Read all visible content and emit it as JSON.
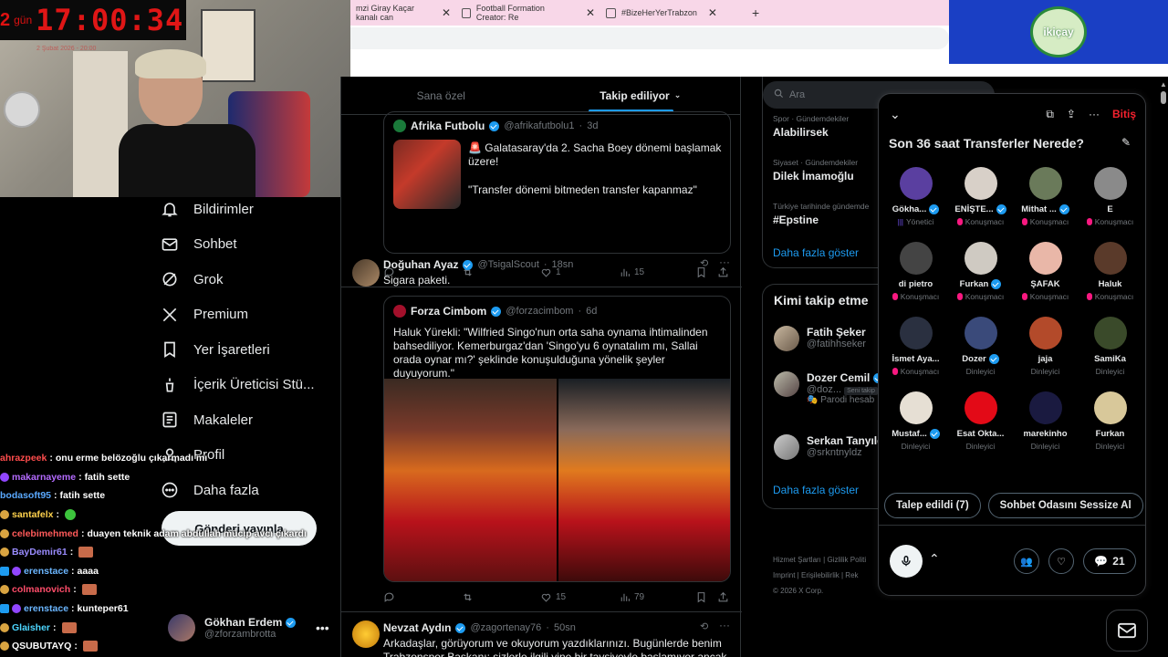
{
  "browser": {
    "tabs": [
      {
        "title": "mzi Giray Kaçar kanalı can"
      },
      {
        "title": "Football Formation Creator: Re"
      },
      {
        "title": "#BizeHerYerTrabzon"
      }
    ],
    "sponsor": "ikiçay"
  },
  "stream": {
    "days": "2",
    "days_label": "gün",
    "timer": "17:00:34",
    "timer_sub": "2 Şubat 2026 - 20:00"
  },
  "nav": {
    "items": [
      {
        "label": "Bildirimler",
        "icon": "bell-icon"
      },
      {
        "label": "Sohbet",
        "icon": "mail-icon"
      },
      {
        "label": "Grok",
        "icon": "grok-icon"
      },
      {
        "label": "Premium",
        "icon": "x-icon"
      },
      {
        "label": "Yer İşaretleri",
        "icon": "bookmark-icon"
      },
      {
        "label": "İçerik Üreticisi Stü...",
        "icon": "creator-icon"
      },
      {
        "label": "Makaleler",
        "icon": "article-icon"
      },
      {
        "label": "Profil",
        "icon": "user-icon"
      },
      {
        "label": "Daha fazla",
        "icon": "more-circle-icon"
      }
    ],
    "post_button": "Gönderi yayınla",
    "account": {
      "name": "Gökhan Erdem",
      "handle": "@zforzambrotta"
    }
  },
  "chat": [
    {
      "user": "ahrazpeek",
      "color": "#ff4d4d",
      "text": "onu erme belözoğlu çıkarmadı mı"
    },
    {
      "user": "makarnayeme",
      "color": "#b46bff",
      "text": "fatih sette"
    },
    {
      "user": "bodasoft95",
      "color": "#5aa9ff",
      "text": "fatih sette"
    },
    {
      "user": "santafelx",
      "color": "#ffd24d",
      "text": ""
    },
    {
      "user": "celebimehmed",
      "color": "#ff5a5a",
      "text": "duayen teknik adam abdullah mücip avcı çıkardı"
    },
    {
      "user": "BayDemir61",
      "color": "#9a8cff",
      "text": ""
    },
    {
      "user": "erenstace",
      "color": "#6bb6ff",
      "text": "aaaa"
    },
    {
      "user": "colmanovich",
      "color": "#ff4d6a",
      "text": ""
    },
    {
      "user": "erenstace",
      "color": "#6bb6ff",
      "text": "kunteper61"
    },
    {
      "user": "Glaisher",
      "color": "#4dd6ff",
      "text": ""
    },
    {
      "user": "QSUBUTAYQ",
      "color": "#ffffff",
      "text": ""
    }
  ],
  "feed": {
    "tabs": [
      "Sana özel",
      "Takip ediliyor"
    ],
    "posts": [
      {
        "name": "Afrika Futbolu",
        "handle": "@afrikafutbolu1",
        "time": "3d",
        "text": "🚨 Galatasaray'da 2. Sacha Boey dönemi başlamak üzere!",
        "text2": "\"Transfer dönemi bitmeden transfer kapanmaz\"",
        "likes": "1",
        "views": "15"
      },
      {
        "name": "Doğuhan Ayaz",
        "handle": "@TsigalScout",
        "time": "18sn",
        "text": "Sigara paketi.",
        "quote": {
          "name": "Forza Cimbom",
          "handle": "@forzacimbom",
          "time": "6d",
          "text": "Haluk Yürekli: \"Wilfried Singo'nun orta saha oynama ihtimalinden bahsediliyor. Kemerburgaz'dan 'Singo'yu 6 oynatalım mı, Sallai orada oynar mı?' şeklinde konuşulduğuna yönelik şeyler duyuyorum.\""
        },
        "likes": "15",
        "views": "79"
      },
      {
        "name": "Nevzat Aydın",
        "handle": "@zagortenay76",
        "time": "50sn",
        "text": "Arkadaşlar, görüyorum ve okuyorum yazdıklarınızı. Bugünlerde benim Trabzonspor Başkanı; sizlerle ilgili yine bir tavsiyeyle başlamıyor ancak aynen"
      }
    ]
  },
  "right": {
    "search_placeholder": "Ara",
    "trends": [
      {
        "cat": "Spor · Gündemdekiler",
        "name": "Alabilirsek"
      },
      {
        "cat": "Siyaset · Gündemdekiler",
        "name": "Dilek İmamoğlu"
      },
      {
        "cat": "Türkiye tarihinde gündemde",
        "name": "#Epstine"
      }
    ],
    "show_more": "Daha fazla göster",
    "who_to_follow": "Kimi takip etme",
    "follow": [
      {
        "name": "Fatih Şeker",
        "handle": "@fatihhseker"
      },
      {
        "name": "Dozer Cemil",
        "handle": "@doz...",
        "badge": "Seni takip",
        "note": "Parodi hesab"
      },
      {
        "name": "Serkan Tanyıld",
        "handle": "@srkntnyldz"
      }
    ],
    "footer": [
      "Hizmet Şartları",
      "Gizlilik Politi",
      "Imprint",
      "Erişilebilirlik",
      "Rek",
      "© 2026 X Corp."
    ]
  },
  "space": {
    "end_label": "Bitiş",
    "title": "Son 36 saat Transferler Nerede?",
    "participants": [
      {
        "name": "Gökha...",
        "role": "Yönetici",
        "verified": true,
        "color": "#5a3fa0"
      },
      {
        "name": "ENİŞTE...",
        "role": "Konuşmacı",
        "verified": true,
        "color": "#d8d0c8"
      },
      {
        "name": "Mithat ...",
        "role": "Konuşmacı",
        "verified": true,
        "color": "#6a7a5a"
      },
      {
        "name": "E",
        "role": "Konuşmacı",
        "verified": false,
        "color": "#8a8a8a"
      },
      {
        "name": "di pietro",
        "role": "Konuşmacı",
        "verified": false,
        "color": "#444"
      },
      {
        "name": "Furkan",
        "role": "Konuşmacı",
        "verified": true,
        "color": "#cfcac2"
      },
      {
        "name": "ŞAFAK",
        "role": "Konuşmacı",
        "verified": false,
        "color": "#e9b7a8"
      },
      {
        "name": "Haluk",
        "role": "Konuşmacı",
        "verified": false,
        "color": "#5a3a2a"
      },
      {
        "name": "İsmet Aya...",
        "role": "Konuşmacı",
        "verified": false,
        "color": "#2a3040"
      },
      {
        "name": "Dozer",
        "role": "Dinleyici",
        "verified": true,
        "color": "#3a4a7a"
      },
      {
        "name": "jaja",
        "role": "Dinleyici",
        "verified": false,
        "color": "#b34a2a"
      },
      {
        "name": "SamiKa",
        "role": "Dinleyici",
        "verified": false,
        "color": "#3a4a2a"
      },
      {
        "name": "Mustaf...",
        "role": "Dinleyici",
        "verified": true,
        "color": "#e6dfd4"
      },
      {
        "name": "Esat Okta...",
        "role": "Dinleyici",
        "verified": false,
        "color": "#e30a17"
      },
      {
        "name": "marekinho",
        "role": "Dinleyici",
        "verified": false,
        "color": "#1a1a40"
      },
      {
        "name": "Furkan",
        "role": "Dinleyici",
        "verified": false,
        "color": "#d8c89a"
      }
    ],
    "requests": "Talep edildi (7)",
    "mute": "Sohbet Odasını Sessize Al",
    "count": "21"
  }
}
